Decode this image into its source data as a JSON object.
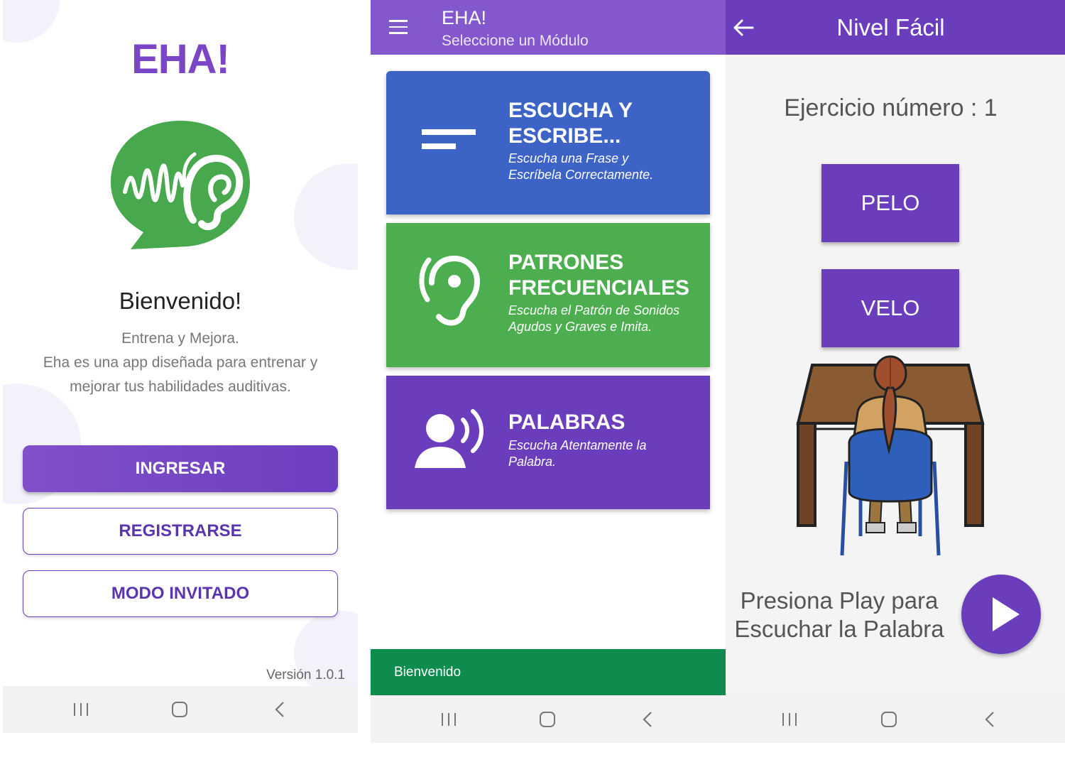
{
  "screen1": {
    "logo": "EHA!",
    "welcome_title": "Bienvenido!",
    "tagline": "Entrena y Mejora.",
    "description": "Eha es una app diseñada para entrenar y mejorar tus habilidades auditivas.",
    "buttons": {
      "login": "INGRESAR",
      "register": "REGISTRARSE",
      "guest": "MODO INVITADO"
    },
    "version": "Versión 1.0.1"
  },
  "screen2": {
    "app_title": "EHA!",
    "subtitle": "Seleccione un Módulo",
    "modules": [
      {
        "title_line1": "ESCUCHA Y",
        "title_line2": "ESCRIBE...",
        "desc_line1": "Escucha una Frase y",
        "desc_line2": "Escríbela Correctamente.",
        "color": "#3d63c6",
        "icon": "short-text-icon"
      },
      {
        "title_line1": "PATRONES",
        "title_line2": "FRECUENCIALES",
        "desc_line1": "Escucha el Patrón de Sonidos",
        "desc_line2": "Agudos y Graves e Imita.",
        "color": "#4cae4f",
        "icon": "hearing-icon"
      },
      {
        "title_line1": "PALABRAS",
        "desc_line1": "Escucha Atentamente la",
        "desc_line2": "Palabra.",
        "color": "#6a3dbd",
        "icon": "record-voice-icon"
      }
    ],
    "status_message": "Bienvenido"
  },
  "screen3": {
    "title": "Nivel Fácil",
    "exercise_label": "Ejercicio número : 1",
    "options": [
      "PELO",
      "VELO"
    ],
    "prompt_line1": "Presiona Play para",
    "prompt_line2": "Escuchar la Palabra"
  },
  "colors": {
    "purple": "#6a3dbd",
    "light_purple": "#8258cc",
    "blue": "#3d63c6",
    "green": "#4cae4f",
    "status_green": "#0e8c4e",
    "logo_green": "#48a84d"
  }
}
